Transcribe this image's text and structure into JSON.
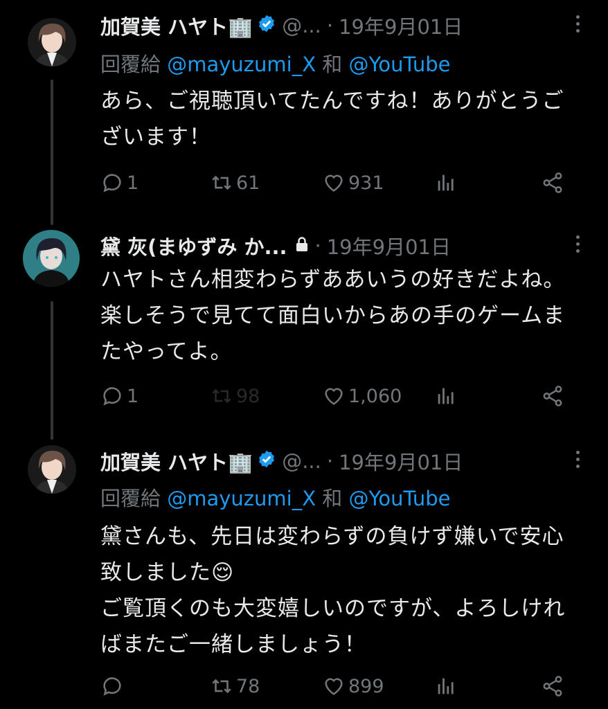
{
  "tweets": [
    {
      "author": "加賀美 ハヤト🏢",
      "verified": true,
      "handle": "@...",
      "date": "19年9月01日",
      "reply_to": {
        "prefix": "回覆給",
        "user1": "@mayuzumi_X",
        "and": "和",
        "user2": "@YouTube"
      },
      "text": "あら、ご視聴頂いてたんですね！ありがとうございます！",
      "replies": "1",
      "retweets": "61",
      "likes": "931",
      "avatar_colors": {
        "hair": "#6b5447",
        "skin": "#efd8c8",
        "bg": "#1a1a1a"
      }
    },
    {
      "author": "黛 灰(まゆずみ か...",
      "locked": true,
      "date": "19年9月01日",
      "text": "ハヤトさん相変わらずああいうの好きだよね。楽しそうで見てて面白いからあの手のゲームまたやってよ。",
      "replies": "1",
      "retweets": "98",
      "likes": "1,060",
      "avatar_colors": {
        "hair": "#1e2030",
        "skin": "#e8dcd8",
        "bg": "#2f7f86"
      }
    },
    {
      "author": "加賀美 ハヤト🏢",
      "verified": true,
      "handle": "@...",
      "date": "19年9月01日",
      "reply_to": {
        "prefix": "回覆給",
        "user1": "@mayuzumi_X",
        "and": "和",
        "user2": "@YouTube"
      },
      "text": "黛さんも、先日は変わらずの負けず嫌いで安心致しました😌\nご覧頂くのも大変嬉しいのですが、よろしければまたご一緒しましょう！",
      "replies": "",
      "retweets": "78",
      "likes": "899",
      "avatar_colors": {
        "hair": "#6b5447",
        "skin": "#efd8c8",
        "bg": "#1a1a1a"
      }
    }
  ],
  "icons": [
    "reply-icon",
    "retweet-icon",
    "like-icon",
    "analytics-icon",
    "share-icon",
    "verified-icon",
    "lock-icon",
    "more-icon"
  ],
  "colors": {
    "background": "#000000",
    "text": "#e7e9ea",
    "muted": "#71767b",
    "link": "#1d9bf0",
    "verified": "#1d9bf0"
  }
}
